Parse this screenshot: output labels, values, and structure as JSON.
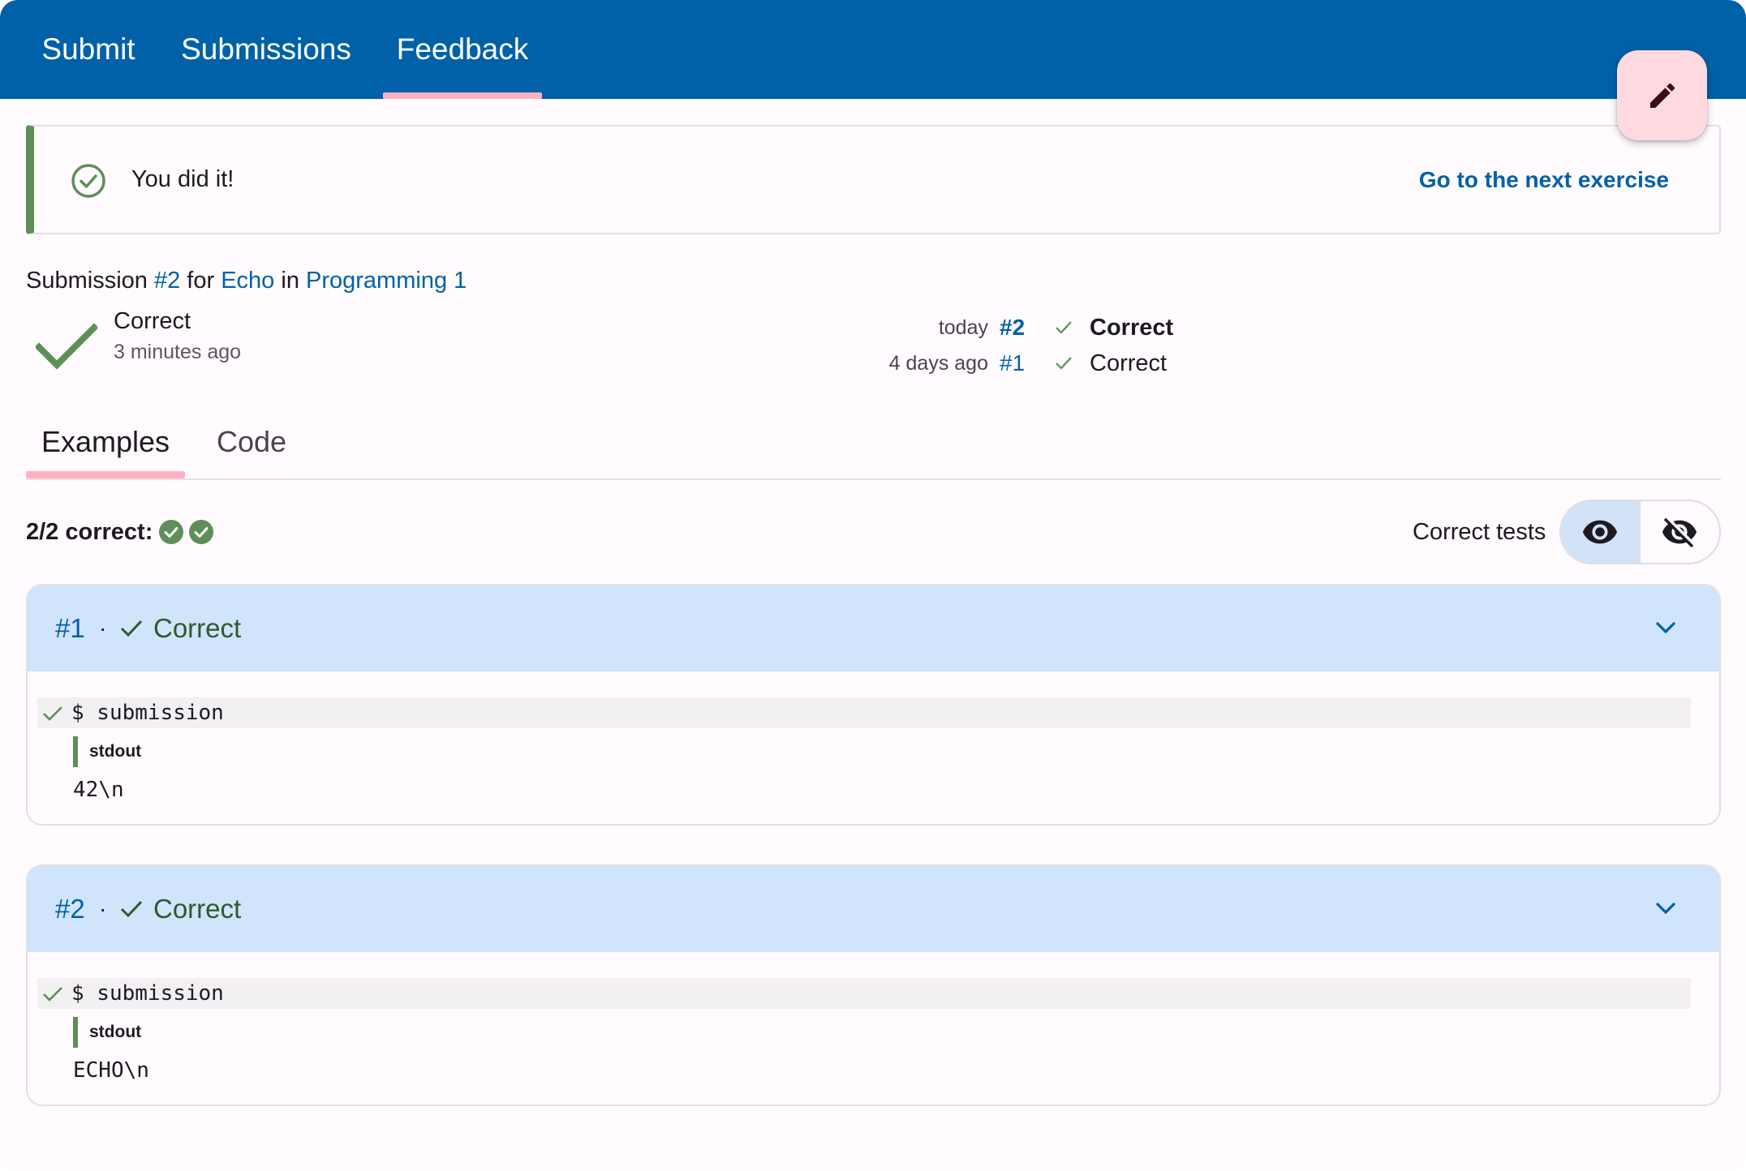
{
  "nav": {
    "tabs": [
      {
        "label": "Submit"
      },
      {
        "label": "Submissions"
      },
      {
        "label": "Feedback"
      }
    ],
    "active_tab": "Feedback"
  },
  "fab": {
    "icon": "pencil-icon"
  },
  "banner": {
    "message": "You did it!",
    "link": "Go to the next exercise",
    "accent_color": "#5f8f59"
  },
  "submission": {
    "prefix": "Submission",
    "number": "#2",
    "for_word": "for",
    "exercise": "Echo",
    "in_word": "in",
    "course": "Programming 1",
    "status": "Correct",
    "time": "3 minutes ago",
    "history": [
      {
        "when": "today",
        "number": "#2",
        "status": "Correct",
        "current": true
      },
      {
        "when": "4 days ago",
        "number": "#1",
        "status": "Correct",
        "current": false
      }
    ]
  },
  "inner_tabs": {
    "items": [
      {
        "label": "Examples"
      },
      {
        "label": "Code"
      }
    ],
    "active": "Examples"
  },
  "summary": {
    "text": "2/2 correct:",
    "passed": 2,
    "correct_tests_label": "Correct tests",
    "show_icon": "eye-icon",
    "hide_icon": "eye-off-icon"
  },
  "tests": [
    {
      "number": "#1",
      "separator": "·",
      "status": "Correct",
      "command": "$ submission",
      "channel": "stdout",
      "output": "42\\n"
    },
    {
      "number": "#2",
      "separator": "·",
      "status": "Correct",
      "command": "$ submission",
      "channel": "stdout",
      "output": "ECHO\\n"
    }
  ],
  "colors": {
    "primary": "#0061a8",
    "success": "#5f8f59",
    "tab_indicator": "#ffb1c1",
    "card_header": "#d0e4fb"
  }
}
